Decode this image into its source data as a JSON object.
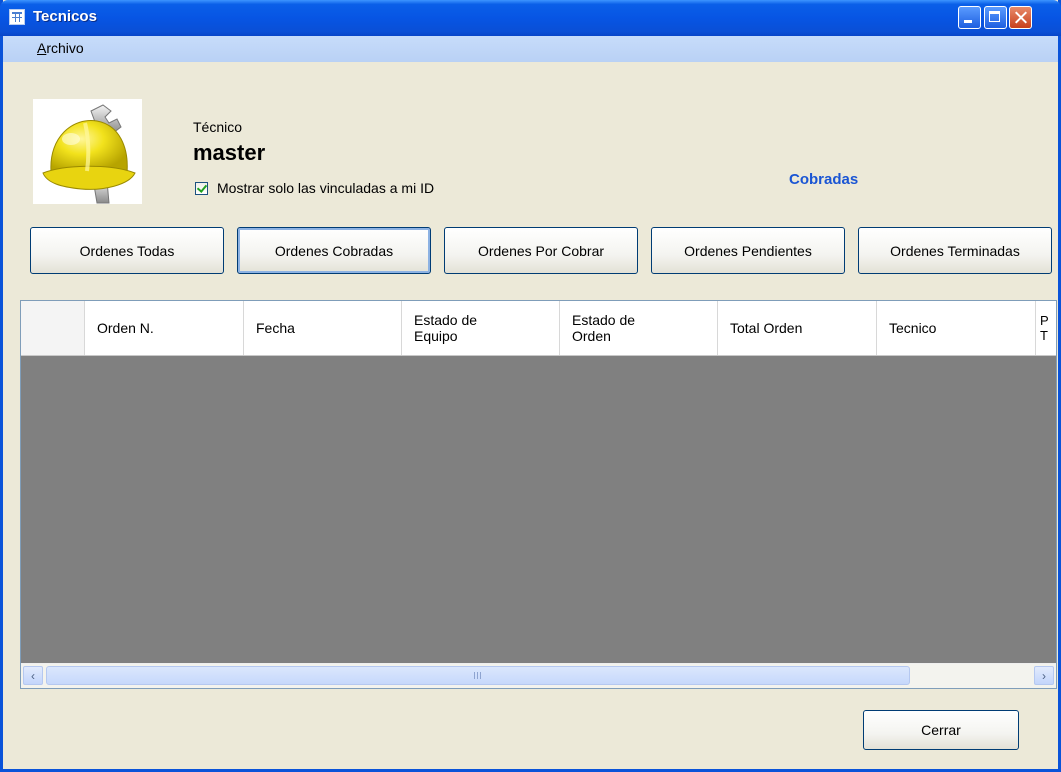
{
  "window": {
    "title": "Tecnicos"
  },
  "menu": {
    "archivo_mnemonic": "A",
    "archivo_rest": "rchivo"
  },
  "header": {
    "label": "Técnico",
    "user": "master",
    "checkbox_label": "Mostrar solo las vinculadas a mi ID",
    "checkbox_checked": true,
    "filter_label": "Cobradas"
  },
  "buttons": {
    "todas": "Ordenes Todas",
    "cobradas": "Ordenes Cobradas",
    "por_cobrar": "Ordenes Por Cobrar",
    "pendientes": "Ordenes Pendientes",
    "terminadas": "Ordenes Terminadas",
    "cerrar": "Cerrar"
  },
  "grid": {
    "columns": {
      "orden": "Orden N.",
      "fecha": "Fecha",
      "estado_equipo_1": "Estado de",
      "estado_equipo_2": "Equipo",
      "estado_orden_1": "Estado de",
      "estado_orden_2": "Orden",
      "total": "Total Orden",
      "tecnico": "Tecnico",
      "clipped_1": "P",
      "clipped_2": "T"
    },
    "scroll_grip": "III"
  },
  "icons": {
    "app": "grid-window-icon",
    "avatar": "hardhat-wrench-icon",
    "scroll_left": "‹",
    "scroll_right": "›"
  }
}
